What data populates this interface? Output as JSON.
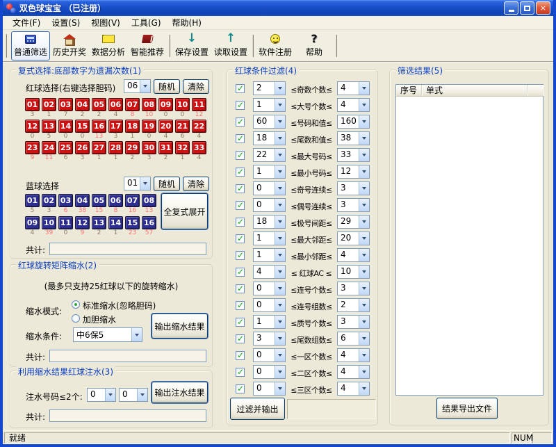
{
  "window": {
    "title": "双色球宝宝 （已注册）"
  },
  "menu": {
    "items": [
      "文件(F)",
      "设置(S)",
      "视图(V)",
      "工具(G)",
      "帮助(H)"
    ]
  },
  "toolbar": {
    "buttons": [
      {
        "name": "normal-filter",
        "label": "普通筛选",
        "icon": "calculator-icon",
        "active": true,
        "sep_after": false
      },
      {
        "name": "history-draws",
        "label": "历史开奖",
        "icon": "house-icon",
        "active": false,
        "sep_after": false
      },
      {
        "name": "data-analysis",
        "label": "数据分析",
        "icon": "envelope-icon",
        "active": false,
        "sep_after": false
      },
      {
        "name": "smart-recommend",
        "label": "智能推荐",
        "icon": "book-icon",
        "active": false,
        "sep_after": true
      },
      {
        "name": "save-settings",
        "label": "保存设置",
        "icon": "arrow-down-icon",
        "active": false,
        "sep_after": false
      },
      {
        "name": "load-settings",
        "label": "读取设置",
        "icon": "arrow-up-icon",
        "active": false,
        "sep_after": true
      },
      {
        "name": "software-register",
        "label": "软件注册",
        "icon": "smiley-icon",
        "active": false,
        "sep_after": false
      },
      {
        "name": "help",
        "label": "帮助",
        "icon": "question-icon",
        "active": false,
        "sep_after": true
      }
    ]
  },
  "group1": {
    "title": "复式选择:底部数字为遗漏次数(1)",
    "red_label": "红球选择(右键选择胆码)",
    "red_combo": "06",
    "random_label": "随机",
    "clear_label": "清除",
    "red_balls": [
      {
        "n": "01",
        "miss": "3",
        "hot": false
      },
      {
        "n": "02",
        "miss": "1",
        "hot": false
      },
      {
        "n": "03",
        "miss": "7",
        "hot": false
      },
      {
        "n": "04",
        "miss": "2",
        "hot": false
      },
      {
        "n": "05",
        "miss": "2",
        "hot": false
      },
      {
        "n": "06",
        "miss": "4",
        "hot": false
      },
      {
        "n": "07",
        "miss": "8",
        "hot": true
      },
      {
        "n": "08",
        "miss": "10",
        "hot": true
      },
      {
        "n": "09",
        "miss": "0",
        "hot": false
      },
      {
        "n": "10",
        "miss": "0",
        "hot": false
      },
      {
        "n": "11",
        "miss": "12",
        "hot": true
      },
      {
        "n": "12",
        "miss": "0",
        "hot": false
      },
      {
        "n": "13",
        "miss": "5",
        "hot": false
      },
      {
        "n": "14",
        "miss": "0",
        "hot": false
      },
      {
        "n": "15",
        "miss": "0",
        "hot": false
      },
      {
        "n": "16",
        "miss": "13",
        "hot": true
      },
      {
        "n": "17",
        "miss": "3",
        "hot": false
      },
      {
        "n": "18",
        "miss": "1",
        "hot": false
      },
      {
        "n": "19",
        "miss": "0",
        "hot": false
      },
      {
        "n": "20",
        "miss": "4",
        "hot": false
      },
      {
        "n": "21",
        "miss": "6",
        "hot": false
      },
      {
        "n": "22",
        "miss": "4",
        "hot": false
      },
      {
        "n": "23",
        "miss": "9",
        "hot": true
      },
      {
        "n": "24",
        "miss": "11",
        "hot": true
      },
      {
        "n": "25",
        "miss": "6",
        "hot": false
      },
      {
        "n": "26",
        "miss": "3",
        "hot": false
      },
      {
        "n": "27",
        "miss": "1",
        "hot": false
      },
      {
        "n": "28",
        "miss": "1",
        "hot": false
      },
      {
        "n": "29",
        "miss": "2",
        "hot": false
      },
      {
        "n": "30",
        "miss": "3",
        "hot": false
      },
      {
        "n": "31",
        "miss": "2",
        "hot": false
      },
      {
        "n": "32",
        "miss": "1",
        "hot": false
      },
      {
        "n": "33",
        "miss": "4",
        "hot": false
      }
    ],
    "blue_label": "蓝球选择",
    "blue_combo": "01",
    "blue_random_label": "随机",
    "blue_clear_label": "清除",
    "blue_balls": [
      {
        "n": "01",
        "miss": "5",
        "hot": false
      },
      {
        "n": "02",
        "miss": "3",
        "hot": false
      },
      {
        "n": "03",
        "miss": "6",
        "hot": true
      },
      {
        "n": "04",
        "miss": "38",
        "hot": true
      },
      {
        "n": "05",
        "miss": "15",
        "hot": true
      },
      {
        "n": "06",
        "miss": "8",
        "hot": true
      },
      {
        "n": "07",
        "miss": "16",
        "hot": true
      },
      {
        "n": "08",
        "miss": "13",
        "hot": true
      },
      {
        "n": "09",
        "miss": "4",
        "hot": false
      },
      {
        "n": "10",
        "miss": "39",
        "hot": true
      },
      {
        "n": "11",
        "miss": "0",
        "hot": false
      },
      {
        "n": "12",
        "miss": "9",
        "hot": true
      },
      {
        "n": "13",
        "miss": "2",
        "hot": false
      },
      {
        "n": "14",
        "miss": "1",
        "hot": false
      },
      {
        "n": "15",
        "miss": "23",
        "hot": true
      },
      {
        "n": "16",
        "miss": "57",
        "hot": true
      }
    ],
    "expand_label": "全复式展开",
    "total_label": "共计:",
    "total_value": ""
  },
  "group2": {
    "title": "红球旋转矩阵缩水(2)",
    "note": "(最多只支持25红球以下的旋转缩水)",
    "mode_label": "缩水模式:",
    "radio_standard": "标准缩水(忽略胆码)",
    "radio_dan": "加胆缩水",
    "cond_label": "缩水条件:",
    "cond_value": "中6保5",
    "output_label": "输出缩水结果",
    "total_label": "共计:",
    "total_value": ""
  },
  "group3": {
    "title": "利用缩水结果红球注水(3)",
    "inject_label": "注水号码≤2个:",
    "combo1": "0",
    "combo2": "0",
    "output_label": "输出注水结果",
    "total_label": "共计:",
    "total_value": ""
  },
  "group4": {
    "title": "红球条件过滤(4)",
    "rows": [
      {
        "checked": true,
        "min": "2",
        "label": "≤奇数个数≤",
        "max": "4"
      },
      {
        "checked": true,
        "min": "1",
        "label": "≤大号个数≤",
        "max": "4"
      },
      {
        "checked": true,
        "min": "60",
        "label": "≤号码和值≤",
        "max": "160"
      },
      {
        "checked": true,
        "min": "18",
        "label": "≤尾数和值≤",
        "max": "38"
      },
      {
        "checked": true,
        "min": "22",
        "label": "≤最大号码≤",
        "max": "33"
      },
      {
        "checked": true,
        "min": "1",
        "label": "≤最小号码≤",
        "max": "12"
      },
      {
        "checked": true,
        "min": "0",
        "label": "≤奇号连续≤",
        "max": "3"
      },
      {
        "checked": true,
        "min": "0",
        "label": "≤偶号连续≤",
        "max": "3"
      },
      {
        "checked": true,
        "min": "18",
        "label": "≤极号间距≤",
        "max": "29"
      },
      {
        "checked": true,
        "min": "1",
        "label": "≤最大邻距≤",
        "max": "20"
      },
      {
        "checked": true,
        "min": "1",
        "label": "≤最小邻距≤",
        "max": "4"
      },
      {
        "checked": true,
        "min": "4",
        "label": "≤ 红球AC ≤",
        "max": "10"
      },
      {
        "checked": true,
        "min": "0",
        "label": "≤连号个数≤",
        "max": "3"
      },
      {
        "checked": true,
        "min": "0",
        "label": "≤连号组数≤",
        "max": "2"
      },
      {
        "checked": true,
        "min": "1",
        "label": "≤质号个数≤",
        "max": "3"
      },
      {
        "checked": true,
        "min": "3",
        "label": "≤尾数组数≤",
        "max": "6"
      },
      {
        "checked": true,
        "min": "0",
        "label": "≤一区个数≤",
        "max": "4"
      },
      {
        "checked": true,
        "min": "0",
        "label": "≤二区个数≤",
        "max": "4"
      },
      {
        "checked": true,
        "min": "0",
        "label": "≤三区个数≤",
        "max": "4"
      }
    ],
    "filter_label": "过滤并输出"
  },
  "group5": {
    "title": "筛选结果(5)",
    "columns": [
      "序号",
      "单式"
    ],
    "export_label": "结果导出文件"
  },
  "statusbar": {
    "ready": "就绪",
    "num": "NUM"
  },
  "colors": {
    "titlebar_blue": "#1950C8",
    "client_bg": "#ECE9D8",
    "group_title_blue": "#0B3FC4",
    "red_ball": "#CE1111",
    "blue_ball": "#2E2E90",
    "hot_miss": "#FF7070",
    "normal_miss": "#8A7B63"
  }
}
